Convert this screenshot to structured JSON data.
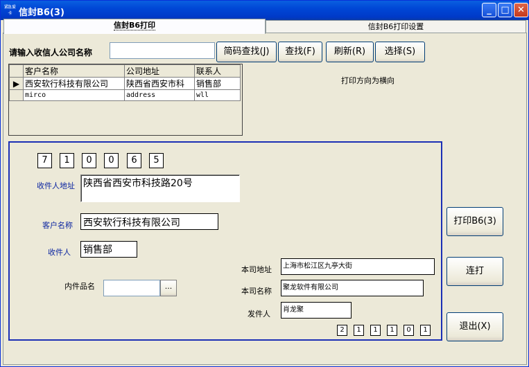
{
  "window": {
    "title": "信封B6(3)",
    "icon_text": "紧急 爱卡",
    "min": "_",
    "max": "□",
    "close": "✕"
  },
  "tabs": [
    {
      "label": "信封B6打印"
    },
    {
      "label": "信封B6打印设置"
    }
  ],
  "search": {
    "label": "请输入收信人公司名称",
    "value": "",
    "btn_pinyin": "简码查找(J)",
    "btn_find": "查找(F)",
    "btn_refresh": "刷新(R)",
    "btn_select": "选择(S)"
  },
  "print_direction": "打印方向为横向",
  "grid": {
    "headers": [
      "客户名称",
      "公司地址",
      "联系人"
    ],
    "rows": [
      {
        "marker": "▶",
        "cells": [
          "西安软行科技有限公司",
          "陕西省西安市科",
          "销售部"
        ]
      },
      {
        "marker": "",
        "cells": [
          "mirco",
          "address",
          "wll"
        ]
      }
    ]
  },
  "recipient": {
    "postcode": [
      "7",
      "1",
      "0",
      "0",
      "6",
      "5"
    ],
    "address_label": "收件人地址",
    "address": "陕西省西安市科技路20号",
    "company_label": "客户名称",
    "company": "西安软行科技有限公司",
    "person_label": "收件人",
    "person": "销售部",
    "contents_label": "内件品名",
    "contents": "",
    "contents_btn": "..."
  },
  "sender": {
    "address_label": "本司地址",
    "address": "上海市松江区九亭大街",
    "company_label": "本司名称",
    "company": "聚龙软件有限公司",
    "person_label": "发件人",
    "person": "肖龙聚",
    "postcode": [
      "2",
      "1",
      "1",
      "1",
      "0",
      "1"
    ]
  },
  "actions": {
    "print": "打印B6(3)",
    "continuous": "连打",
    "exit": "退出(X)"
  }
}
